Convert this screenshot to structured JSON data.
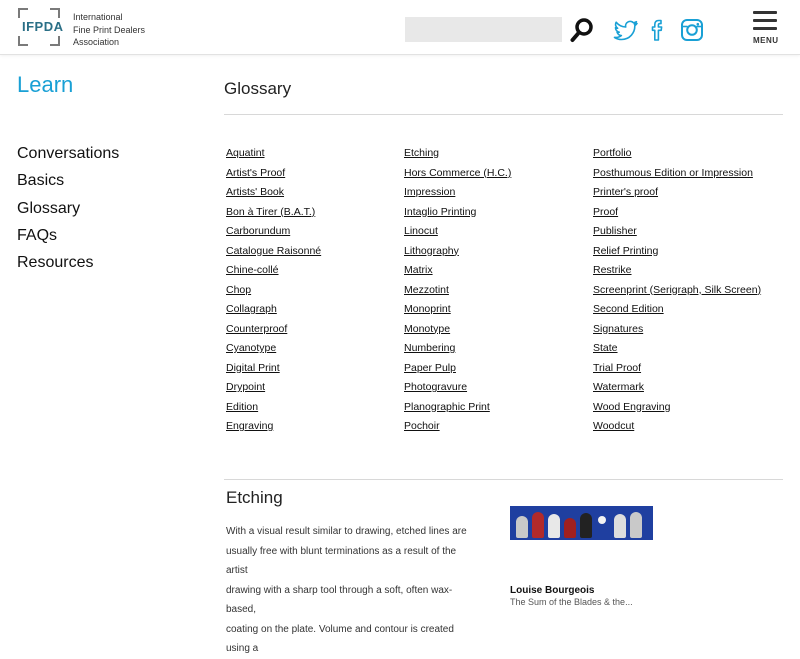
{
  "header": {
    "logo_text": "IFPDA",
    "org_name_lines": [
      "International",
      "Fine Print Dealers",
      "Association"
    ],
    "search_placeholder": "",
    "menu_label": "MENU",
    "icons": [
      "search-icon",
      "twitter-icon",
      "facebook-icon",
      "instagram-icon",
      "hamburger-menu-icon"
    ],
    "social_color": "#19a0d5"
  },
  "sidebar": {
    "title": "Learn",
    "title_color": "#19a0d5",
    "items": [
      "Conversations",
      "Basics",
      "Glossary",
      "FAQs",
      "Resources"
    ]
  },
  "main": {
    "title": "Glossary",
    "columns": [
      [
        "Aquatint",
        "Artist's Proof",
        "Artists' Book",
        "Bon à Tirer (B.A.T.)",
        "Carborundum",
        "Catalogue Raisonné",
        "Chine-collé",
        "Chop",
        "Collagraph",
        "Counterproof",
        "Cyanotype",
        "Digital Print",
        "Drypoint",
        "Edition",
        "Engraving"
      ],
      [
        "Etching",
        "Hors Commerce (H.C.)",
        "Impression",
        "Intaglio Printing",
        "Linocut",
        "Lithography",
        "Matrix",
        "Mezzotint",
        "Monoprint",
        "Monotype",
        "Numbering",
        "Paper Pulp",
        "Photogravure",
        "Planographic Print",
        "Pochoir"
      ],
      [
        "Portfolio",
        "Posthumous Edition or Impression",
        "Printer's proof",
        "Proof",
        "Publisher",
        "Relief Printing",
        "Restrike",
        "Screenprint (Serigraph, Silk Screen)",
        "Second Edition",
        "Signatures",
        "State",
        "Trial Proof",
        "Watermark",
        "Wood Engraving",
        "Woodcut"
      ]
    ]
  },
  "entry": {
    "title": "Etching",
    "body_lines": [
      "With a visual result similar to drawing, etched lines are",
      "usually free with blunt terminations as a result of the artist",
      "drawing with a sharp tool through a soft, often wax-based,",
      "coating on the plate. Volume and contour is created using a"
    ],
    "caption_artist": "Louise Bourgeois",
    "caption_title": "The Sum of the Blades & the..."
  }
}
